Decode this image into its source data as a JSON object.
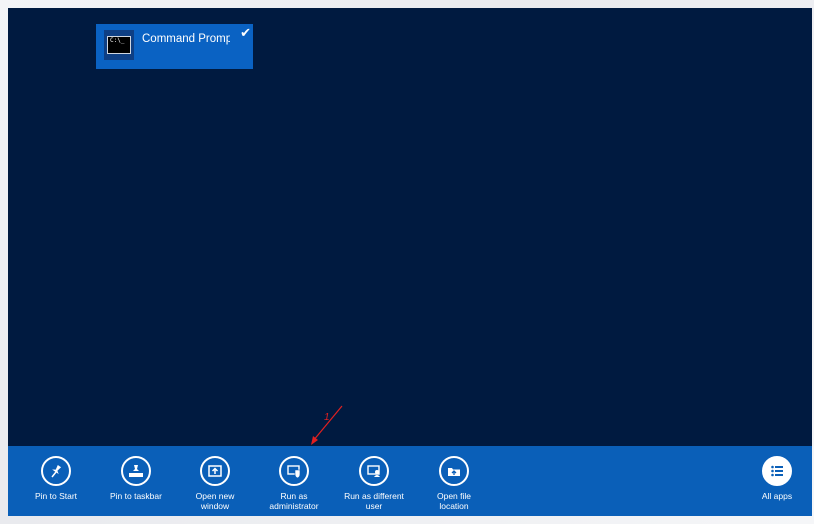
{
  "tile": {
    "label": "Command Prompt",
    "icon": "command-prompt-icon",
    "selected": true
  },
  "appbar": {
    "commands": [
      {
        "label": "Pin to Start",
        "icon": "pin-icon"
      },
      {
        "label": "Pin to taskbar",
        "icon": "pin-to-taskbar-icon"
      },
      {
        "label": "Open new\nwindow",
        "icon": "new-window-icon"
      },
      {
        "label": "Run as\nadministrator",
        "icon": "shield-admin-icon"
      },
      {
        "label": "Run as different\nuser",
        "icon": "different-user-icon"
      },
      {
        "label": "Open file\nlocation",
        "icon": "folder-icon"
      },
      {
        "label": "All apps",
        "icon": "all-apps-icon"
      }
    ]
  },
  "annotation": {
    "label": "1",
    "color": "#e02020"
  },
  "colors": {
    "background": "#001a40",
    "tile": "#0a62c3",
    "appbar": "#0a5fb8"
  }
}
